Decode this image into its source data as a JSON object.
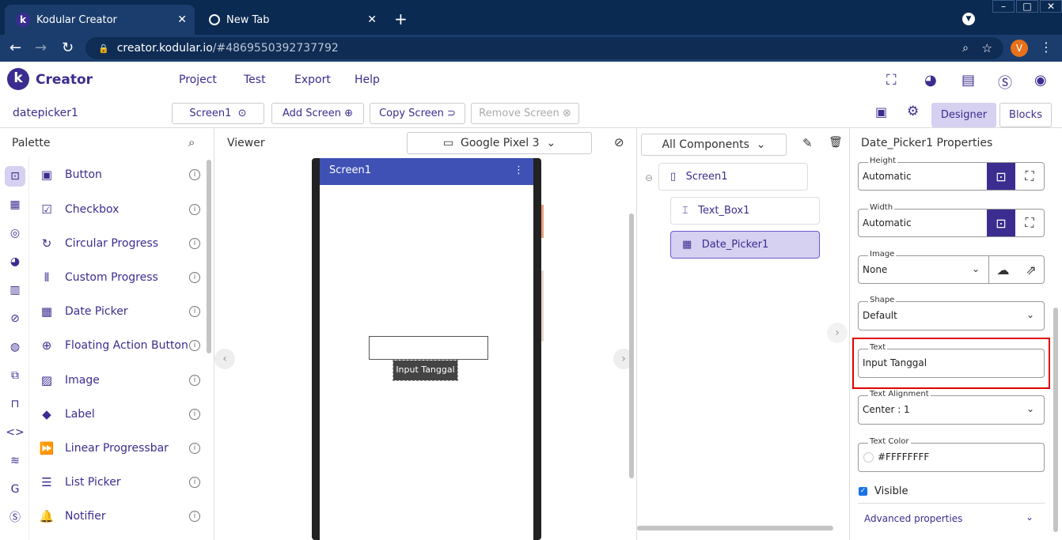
{
  "browser": {
    "tabs": [
      {
        "title": "Kodular Creator",
        "favicon": "k"
      },
      {
        "title": "New Tab"
      }
    ],
    "url_host": "creator.kodular.io",
    "url_path": "/#4869550392737792",
    "profile_initial": "V"
  },
  "app": {
    "logo_letter": "k",
    "brand": "Creator",
    "menu": [
      "Project",
      "Test",
      "Export",
      "Help"
    ]
  },
  "toolbar": {
    "project_name": "datepicker1",
    "screen_select": "Screen1",
    "add_screen": "Add Screen",
    "copy_screen": "Copy Screen",
    "remove_screen": "Remove Screen",
    "designer": "Designer",
    "blocks": "Blocks"
  },
  "palette": {
    "title": "Palette",
    "items": [
      {
        "label": "Button",
        "icon": "▣"
      },
      {
        "label": "Checkbox",
        "icon": "☑"
      },
      {
        "label": "Circular Progress",
        "icon": "↻"
      },
      {
        "label": "Custom Progress",
        "icon": "⦀"
      },
      {
        "label": "Date Picker",
        "icon": "▦"
      },
      {
        "label": "Floating Action Button",
        "icon": "⊕"
      },
      {
        "label": "Image",
        "icon": "▨"
      },
      {
        "label": "Label",
        "icon": "◆"
      },
      {
        "label": "Linear Progressbar",
        "icon": "⏩"
      },
      {
        "label": "List Picker",
        "icon": "☰"
      },
      {
        "label": "Notifier",
        "icon": "🔔"
      }
    ]
  },
  "viewer": {
    "title": "Viewer",
    "device": "Google Pixel 3",
    "screen_title": "Screen1",
    "datepicker_text": "Input Tanggal"
  },
  "components": {
    "selector": "All Components",
    "tree": [
      "Screen1",
      "Text_Box1",
      "Date_Picker1"
    ]
  },
  "properties": {
    "title": "Date_Picker1 Properties",
    "height": {
      "label": "Height",
      "value": "Automatic"
    },
    "width": {
      "label": "Width",
      "value": "Automatic"
    },
    "image": {
      "label": "Image",
      "value": "None"
    },
    "shape": {
      "label": "Shape",
      "value": "Default"
    },
    "text": {
      "label": "Text",
      "value": "Input Tanggal"
    },
    "text_alignment": {
      "label": "Text Alignment",
      "value": "Center : 1"
    },
    "text_color": {
      "label": "Text Color",
      "value": "#FFFFFFFF"
    },
    "visible": {
      "label": "Visible",
      "checked": true
    },
    "advanced": "Advanced properties"
  },
  "colors": {
    "accent": "#3b2d8f",
    "highlight": "#e00000",
    "selected": "#d6d0f1"
  }
}
